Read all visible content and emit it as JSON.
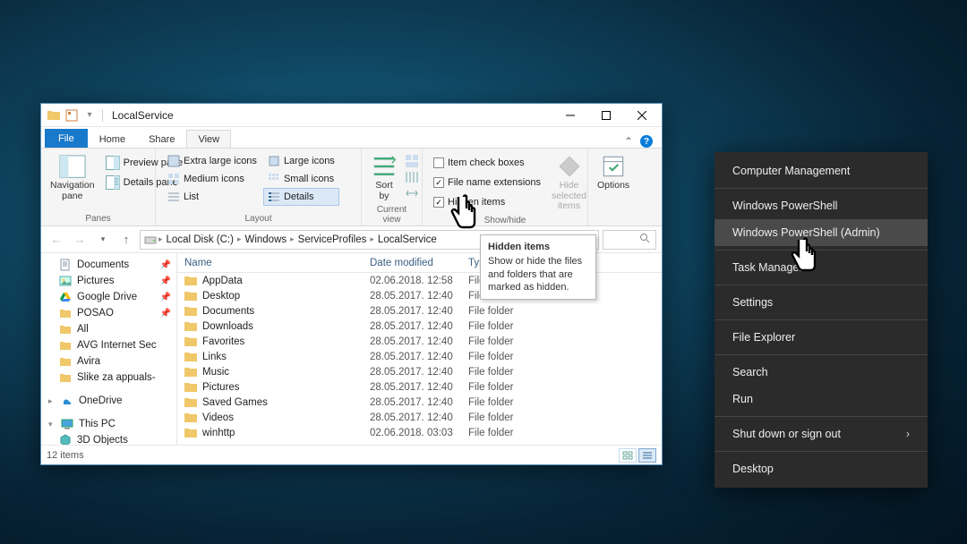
{
  "window": {
    "title": "LocalService",
    "tabs": {
      "file": "File",
      "home": "Home",
      "share": "Share",
      "view": "View"
    },
    "ribbon": {
      "panes": {
        "nav": "Navigation\npane",
        "preview": "Preview pane",
        "details": "Details pane",
        "label": "Panes"
      },
      "layout": {
        "xl": "Extra large icons",
        "lg": "Large icons",
        "md": "Medium icons",
        "sm": "Small icons",
        "list": "List",
        "det": "Details",
        "label": "Layout"
      },
      "currentview": {
        "sort": "Sort\nby",
        "label": "Current view"
      },
      "showhide": {
        "chk1": "Item check boxes",
        "chk2": "File name extensions",
        "chk3": "Hidden items",
        "hide": "Hide selected\nitems",
        "label": "Show/hide"
      },
      "options": {
        "btn": "Options"
      }
    },
    "breadcrumb": [
      "Local Disk (C:)",
      "Windows",
      "ServiceProfiles",
      "LocalService"
    ],
    "columns": {
      "name": "Name",
      "date": "Date modified",
      "type": "Type"
    },
    "files": [
      {
        "name": "AppData",
        "date": "02.06.2018. 12:58",
        "type": "File folder"
      },
      {
        "name": "Desktop",
        "date": "28.05.2017. 12:40",
        "type": "File folder"
      },
      {
        "name": "Documents",
        "date": "28.05.2017. 12:40",
        "type": "File folder"
      },
      {
        "name": "Downloads",
        "date": "28.05.2017. 12:40",
        "type": "File folder"
      },
      {
        "name": "Favorites",
        "date": "28.05.2017. 12:40",
        "type": "File folder"
      },
      {
        "name": "Links",
        "date": "28.05.2017. 12:40",
        "type": "File folder"
      },
      {
        "name": "Music",
        "date": "28.05.2017. 12:40",
        "type": "File folder"
      },
      {
        "name": "Pictures",
        "date": "28.05.2017. 12:40",
        "type": "File folder"
      },
      {
        "name": "Saved Games",
        "date": "28.05.2017. 12:40",
        "type": "File folder"
      },
      {
        "name": "Videos",
        "date": "28.05.2017. 12:40",
        "type": "File folder"
      },
      {
        "name": "winhttp",
        "date": "02.06.2018. 03:03",
        "type": "File folder"
      }
    ],
    "sidebar": [
      {
        "label": "Documents",
        "pin": true,
        "ico": "doc"
      },
      {
        "label": "Pictures",
        "pin": true,
        "ico": "pic"
      },
      {
        "label": "Google Drive",
        "pin": true,
        "ico": "gd"
      },
      {
        "label": "POSAO",
        "pin": true,
        "ico": "folder"
      },
      {
        "label": "All",
        "pin": false,
        "ico": "folder"
      },
      {
        "label": "AVG Internet Sec",
        "pin": false,
        "ico": "folder"
      },
      {
        "label": "Avira",
        "pin": false,
        "ico": "folder"
      },
      {
        "label": "Slike za appuals-",
        "pin": false,
        "ico": "folder"
      }
    ],
    "sidebar_roots": {
      "onedrive": "OneDrive",
      "thispc": "This PC",
      "obj3d": "3D Objects"
    },
    "status": "12 items",
    "tooltip": {
      "title": "Hidden items",
      "body": "Show or hide the files and folders that are marked as hidden."
    }
  },
  "ctx": {
    "items": [
      "Computer Management",
      "Windows PowerShell",
      "Windows PowerShell (Admin)",
      "Task Manager",
      "Settings",
      "File Explorer",
      "Search",
      "Run",
      "Shut down or sign out",
      "Desktop"
    ]
  }
}
